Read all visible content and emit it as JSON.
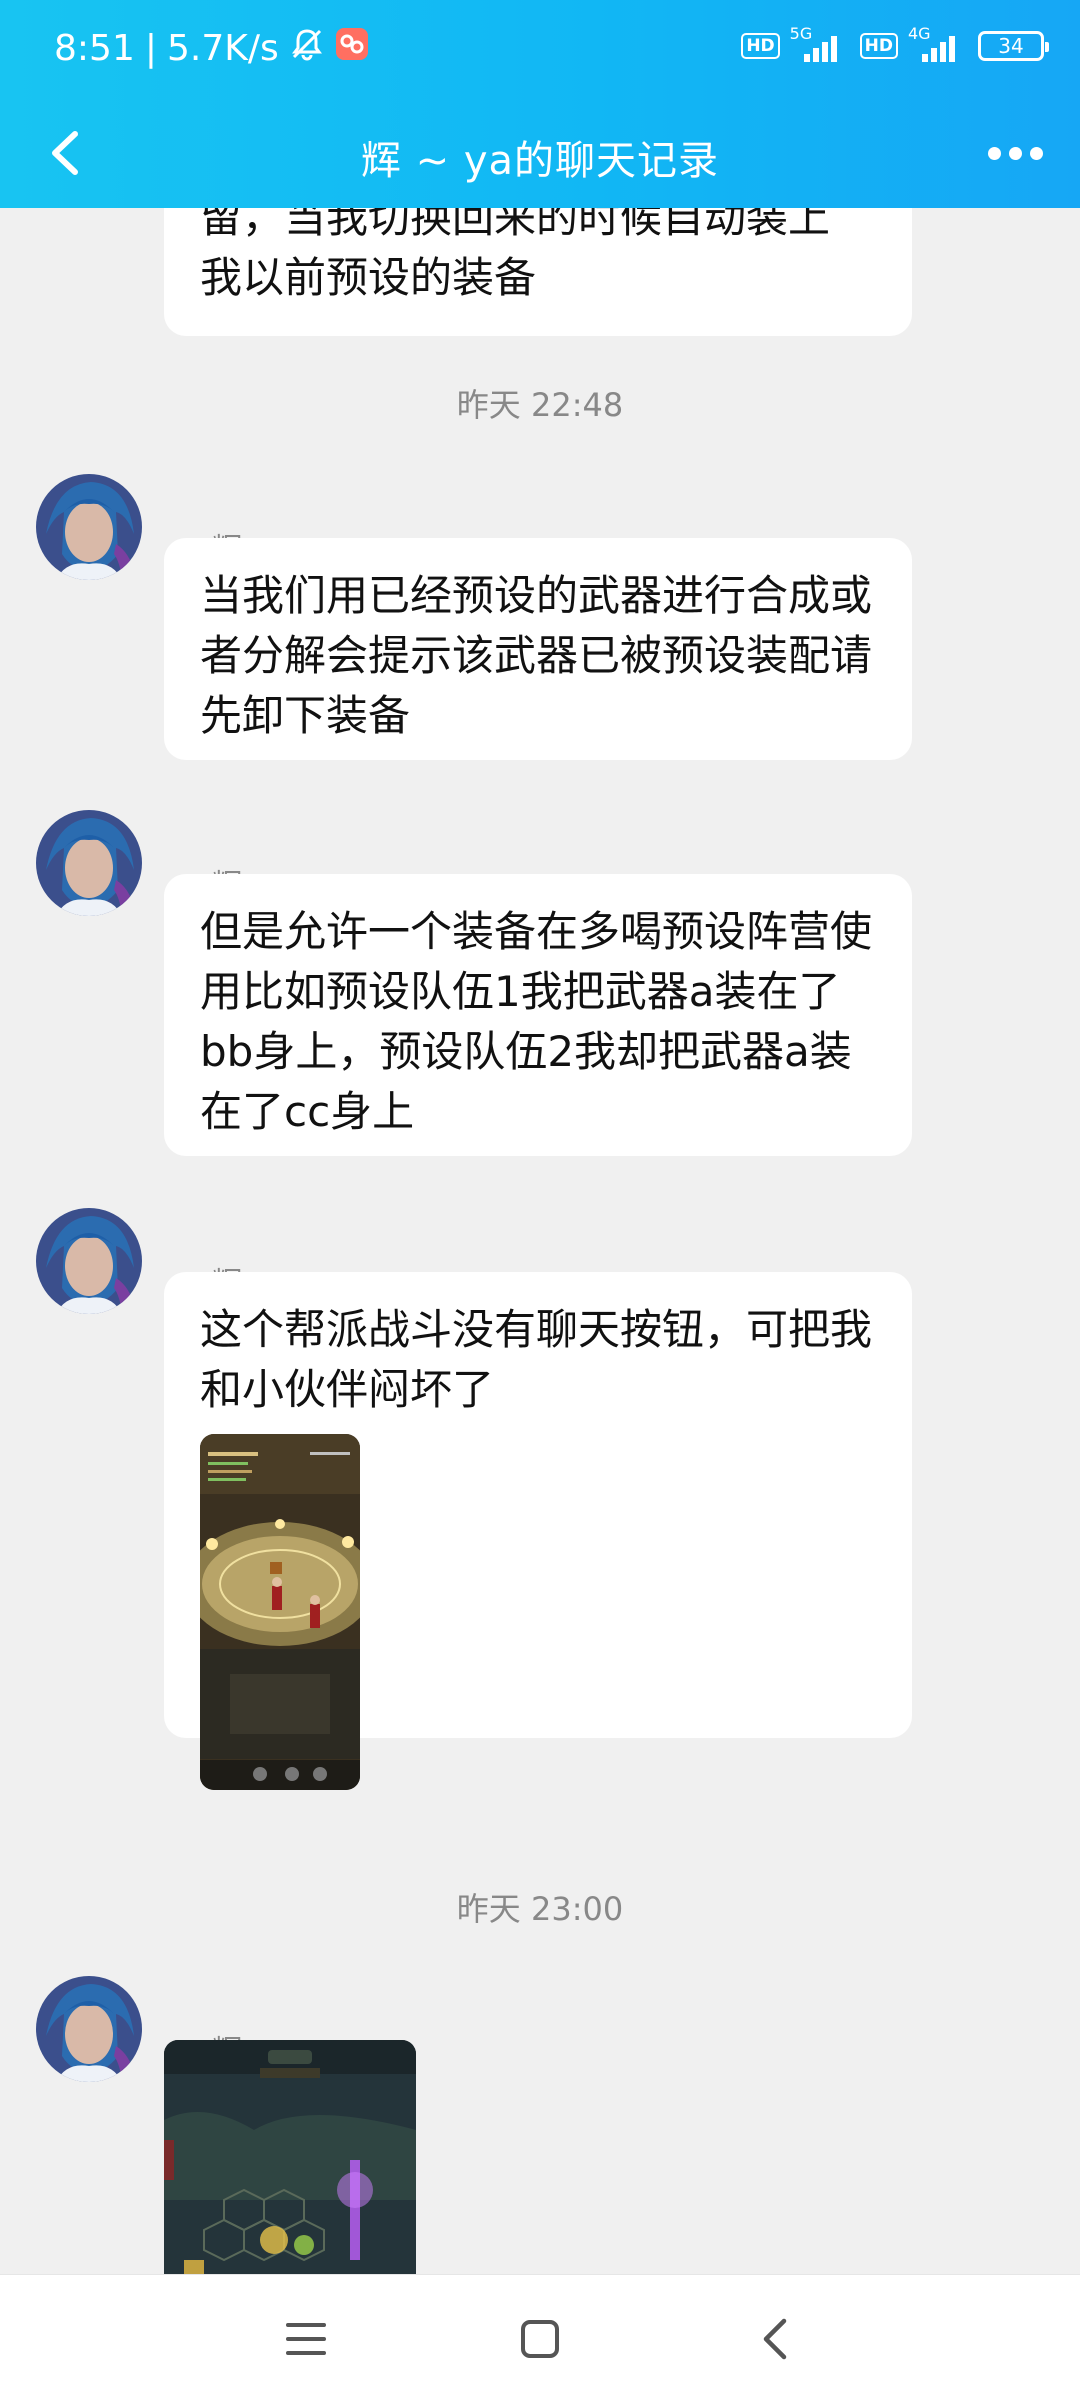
{
  "status_bar": {
    "time": "8:51",
    "separator": "|",
    "net_speed": "5.7K/s",
    "hd1": "HD",
    "net1": "5G",
    "hd2": "HD",
    "net2": "4G",
    "battery": "34"
  },
  "header": {
    "title": "辉 ~ ya的聊天记录"
  },
  "chat": {
    "partial_message": "留，当我切换回来的时候自动装上\n我以前预设的装备",
    "timestamp1": "昨天 22:48",
    "messages": [
      {
        "sender": "辉 ~ ya",
        "text": "当我们用已经预设的武器进行合成或者分解会提示该武器已被预设装配请先卸下装备"
      },
      {
        "sender": "辉 ~ ya",
        "text": "但是允许一个装备在多喝预设阵营使用比如预设队伍1我把武器a装在了bb身上，预设队伍2我却把武器a装在了cc身上"
      },
      {
        "sender": "辉 ~ ya",
        "text": "这个帮派战斗没有聊天按钮，可把我和小伙伴闷坏了"
      },
      {
        "sender": "辉 ~ ya"
      }
    ],
    "timestamp2": "昨天 23:00"
  },
  "colors": {
    "header_start": "#18c4f2",
    "header_end": "#16a7f5",
    "chat_bg": "#f0f0f0",
    "bubble_bg": "#ffffff",
    "meta_text": "#888888"
  },
  "icons": {
    "back": "chevron-left-icon",
    "more": "more-dots-icon",
    "menu": "menu-icon",
    "home": "home-square-icon",
    "nav_back": "back-triangle-icon"
  }
}
